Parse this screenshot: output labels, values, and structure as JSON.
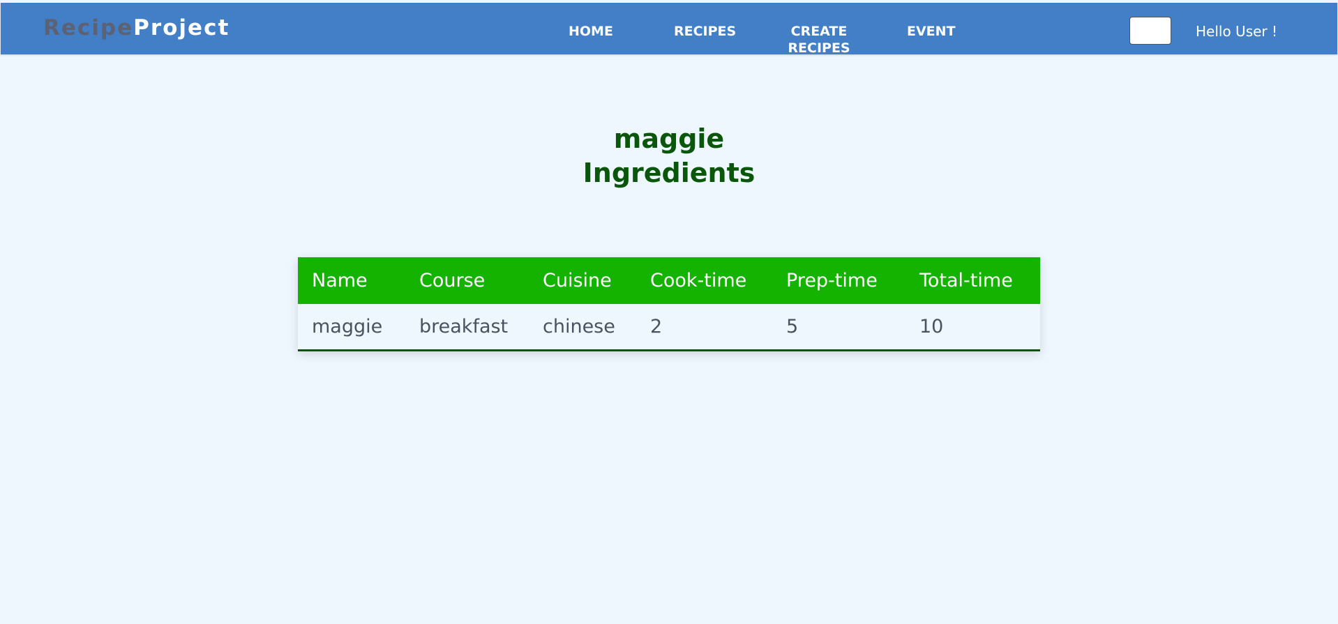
{
  "navbar": {
    "brand_part1": "Recipe",
    "brand_part2": "Project",
    "links": {
      "home": "HOME",
      "recipes": "RECIPES",
      "create_recipes_line1": "CREATE",
      "create_recipes_line2": "RECIPES",
      "event": "EVENT"
    },
    "search_value": "",
    "greeting": "Hello User !"
  },
  "title": {
    "line1": "maggie",
    "line2": "Ingredients"
  },
  "table": {
    "headers": [
      "Name",
      "Course",
      "Cuisine",
      "Cook-time",
      "Prep-time",
      "Total-time"
    ],
    "rows": [
      [
        "maggie",
        "breakfast",
        "chinese",
        "2",
        "5",
        "10"
      ]
    ]
  },
  "colors": {
    "navbar_bg": "#427fc7",
    "page_bg": "#eff7fe",
    "title_color": "#0a560b",
    "table_header_bg": "#13b300",
    "row_text": "#4b5160",
    "brand_muted": "#5c6273"
  }
}
